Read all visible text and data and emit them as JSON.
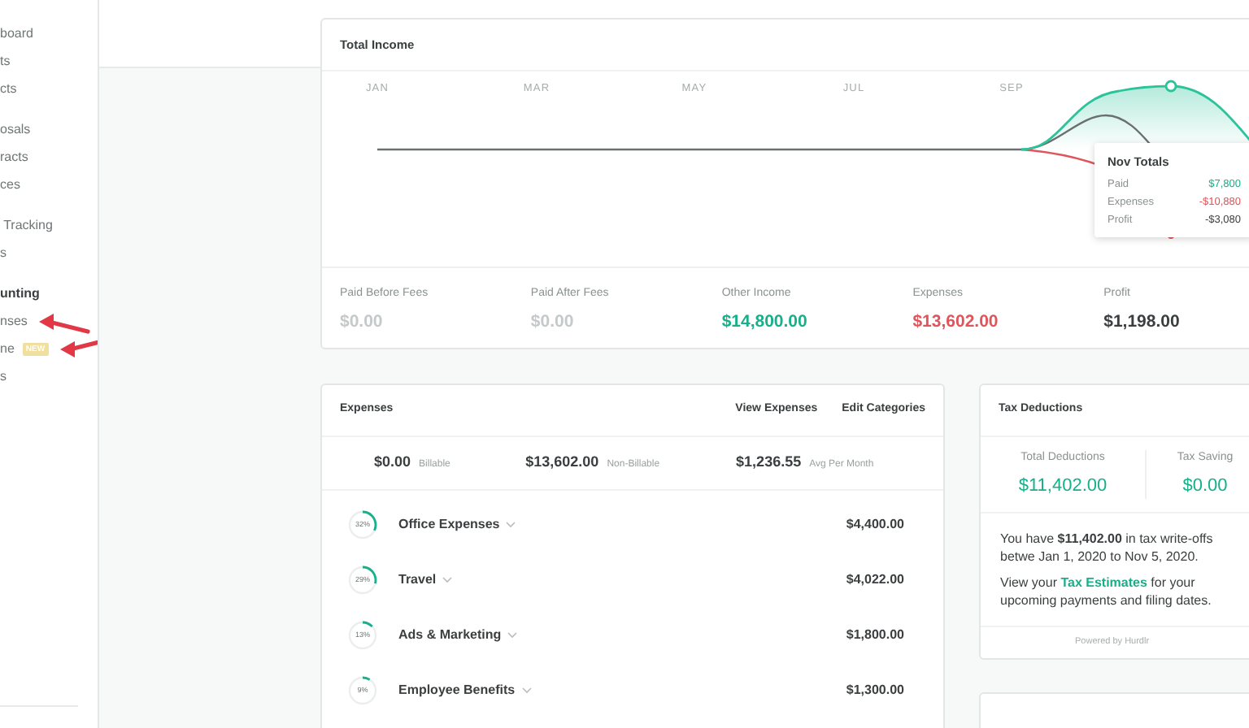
{
  "sidebar": {
    "groups": [
      {
        "items": [
          {
            "label": "board",
            "kind": "item"
          },
          {
            "label": "ts",
            "kind": "item"
          },
          {
            "label": "cts",
            "kind": "item"
          }
        ]
      },
      {
        "items": [
          {
            "label": "osals",
            "kind": "item"
          },
          {
            "label": "racts",
            "kind": "item"
          },
          {
            "label": "ces",
            "kind": "item"
          }
        ]
      },
      {
        "items": [
          {
            "label": " Tracking",
            "kind": "item"
          },
          {
            "label": "s",
            "kind": "item"
          }
        ]
      },
      {
        "items": [
          {
            "label": "unting",
            "kind": "header"
          },
          {
            "label": "nses",
            "kind": "item",
            "arrow": true
          },
          {
            "label": "ne",
            "kind": "item",
            "badge": "NEW",
            "arrow": true
          },
          {
            "label": "s",
            "kind": "item"
          }
        ]
      }
    ]
  },
  "income_card": {
    "title": "Total Income",
    "months": [
      "JAN",
      "MAR",
      "MAY",
      "JUL",
      "SEP"
    ],
    "tooltip": {
      "title": "Nov Totals",
      "rows": [
        {
          "label": "Paid",
          "value": "$7,800",
          "kind": "positive"
        },
        {
          "label": "Expenses",
          "value": "-$10,880",
          "kind": "negative"
        },
        {
          "label": "Profit",
          "value": "-$3,080",
          "kind": "neutral"
        }
      ]
    },
    "stats": [
      {
        "label": "Paid Before Fees",
        "value": "$0.00",
        "kind": "muted"
      },
      {
        "label": "Paid After Fees",
        "value": "$0.00",
        "kind": "muted"
      },
      {
        "label": "Other Income",
        "value": "$14,800.00",
        "kind": "positive"
      },
      {
        "label": "Expenses",
        "value": "$13,602.00",
        "kind": "negative"
      },
      {
        "label": "Profit",
        "value": "$1,198.00",
        "kind": "neutral"
      }
    ]
  },
  "expenses_card": {
    "title": "Expenses",
    "links": [
      "View Expenses",
      "Edit Categories"
    ],
    "summary": [
      {
        "value": "$0.00",
        "label": "Billable"
      },
      {
        "value": "$13,602.00",
        "label": "Non-Billable"
      },
      {
        "value": "$1,236.55",
        "label": "Avg Per Month"
      }
    ],
    "rows": [
      {
        "percent": "32%",
        "level": 0.32,
        "name": "Office Expenses",
        "amount": "$4,400.00"
      },
      {
        "percent": "29%",
        "level": 0.29,
        "name": "Travel",
        "amount": "$4,022.00"
      },
      {
        "percent": "13%",
        "level": 0.13,
        "name": "Ads & Marketing",
        "amount": "$1,800.00"
      },
      {
        "percent": "9%",
        "level": 0.09,
        "name": "Employee Benefits",
        "amount": "$1,300.00"
      }
    ]
  },
  "tax_card": {
    "title": "Tax Deductions",
    "stats": [
      {
        "label": "Total Deductions",
        "value": "$11,402.00"
      },
      {
        "label": "Tax Saving",
        "value": "$0.00"
      }
    ],
    "summary": "You have **$11,402.00** in tax write-offs betwe Jan 1, 2020 to Nov 5, 2020.",
    "estimate": {
      "before": "View your",
      "link": "Tax Estimates",
      "after": "for your upcoming payments and filing dates."
    },
    "footer": "Powered by Hurdlr"
  }
}
